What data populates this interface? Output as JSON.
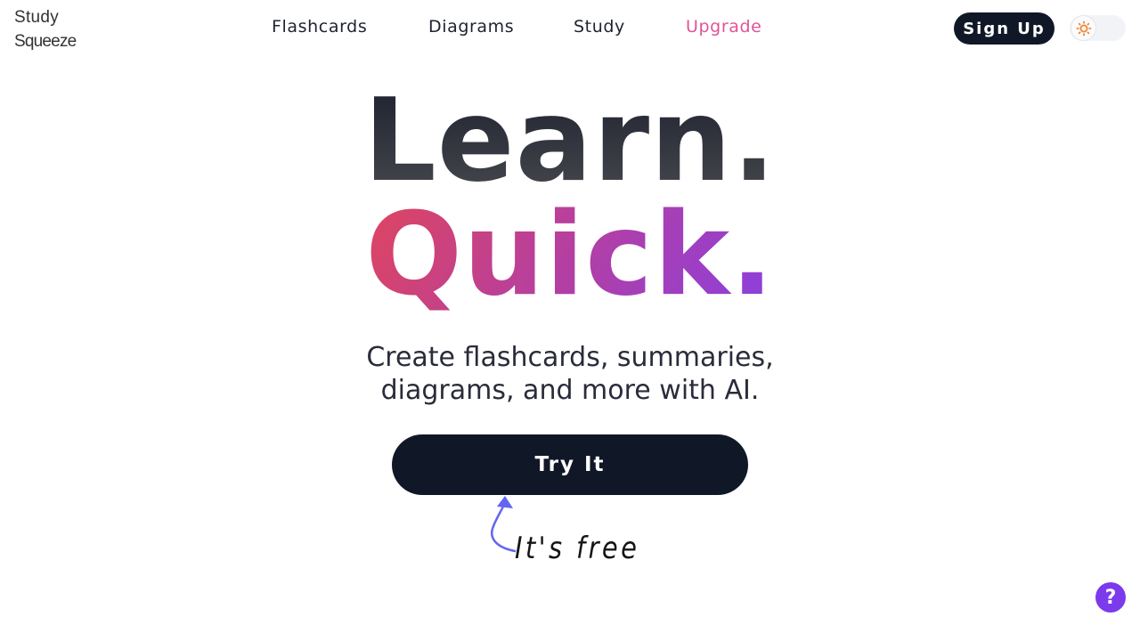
{
  "header": {
    "logo_line1": "Study",
    "logo_line2": "Squeeze",
    "nav": [
      {
        "label": "Flashcards"
      },
      {
        "label": "Diagrams"
      },
      {
        "label": "Study"
      },
      {
        "label": "Upgrade"
      }
    ],
    "signup_label": "Sign Up",
    "theme_toggle": {
      "icon": "sun-icon",
      "state": "light"
    }
  },
  "hero": {
    "headline_line1": "Learn.",
    "headline_line2": "Quick.",
    "subtitle_line1": "Create flashcards, summaries,",
    "subtitle_line2": "diagrams, and more with AI.",
    "cta_label": "Try It",
    "note": "It's free"
  },
  "help": {
    "label": "?"
  },
  "colors": {
    "primary_dark": "#101828",
    "upgrade_pink": "#e0549a",
    "gradient_start": "#e0455d",
    "gradient_end": "#8a3fe0",
    "help_purple": "#7c3aed",
    "arrow_blue": "#6366f1",
    "sun_orange": "#f0842c"
  }
}
